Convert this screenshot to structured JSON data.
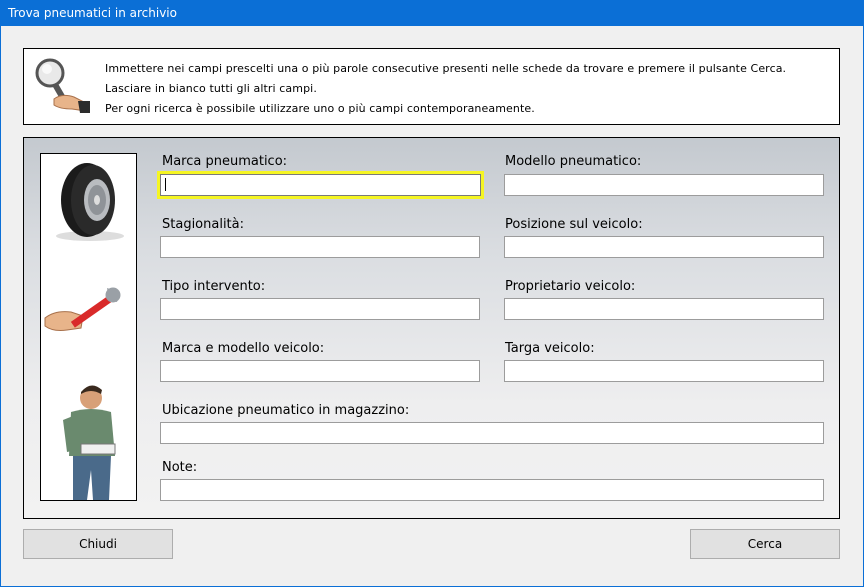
{
  "window": {
    "title": "Trova pneumatici in archivio"
  },
  "info": {
    "icon": "magnifier-in-hand-icon",
    "lines": [
      "Immettere nei campi prescelti una o più parole consecutive presenti nelle schede da trovare e premere il pulsante Cerca.",
      "Lasciare in bianco tutti gli altri campi.",
      "Per ogni ricerca è possibile utilizzare uno o più campi contemporaneamente."
    ]
  },
  "side_images": [
    "tire-icon",
    "wrench-in-hand-icon",
    "mechanic-with-clipboard-icon"
  ],
  "fields": {
    "marca_pneumatico": {
      "label": "Marca pneumatico:",
      "value": ""
    },
    "modello_pneumatico": {
      "label": "Modello pneumatico:",
      "value": ""
    },
    "stagionalita": {
      "label": "Stagionalità:",
      "value": ""
    },
    "posizione_veicolo": {
      "label": "Posizione sul veicolo:",
      "value": ""
    },
    "tipo_intervento": {
      "label": "Tipo intervento:",
      "value": ""
    },
    "proprietario_veicolo": {
      "label": "Proprietario veicolo:",
      "value": ""
    },
    "marca_modello_veicolo": {
      "label": "Marca e modello veicolo:",
      "value": ""
    },
    "targa_veicolo": {
      "label": "Targa veicolo:",
      "value": ""
    },
    "ubicazione_magazzino": {
      "label": "Ubicazione pneumatico in magazzino:",
      "value": ""
    },
    "note": {
      "label": "Note:",
      "value": ""
    }
  },
  "buttons": {
    "close": "Chiudi",
    "search": "Cerca"
  },
  "colors": {
    "titlebar": "#0b6fd6",
    "focus_highlight": "#f5f523"
  }
}
